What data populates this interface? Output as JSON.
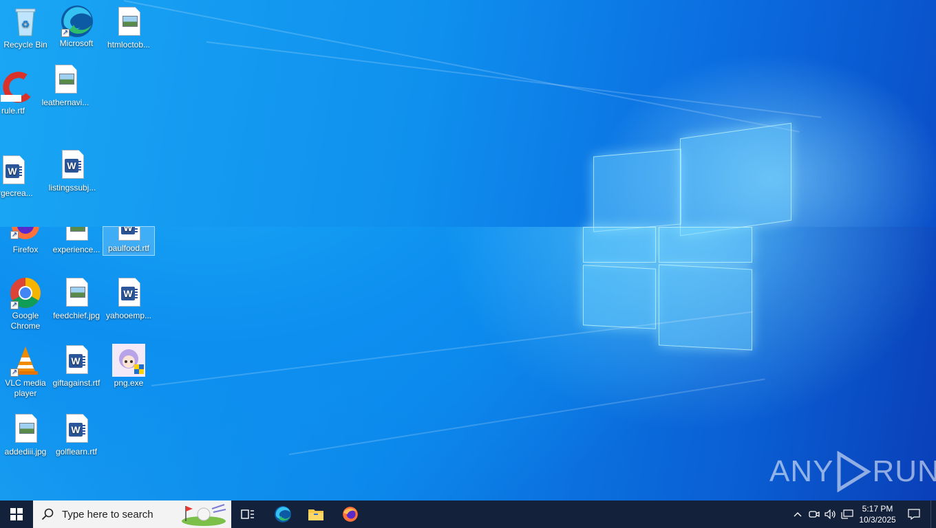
{
  "desktop_icons": [
    {
      "name": "recycle-bin",
      "label": "Recycle Bin"
    },
    {
      "name": "microsoft-edge",
      "label": "Microsoft"
    },
    {
      "name": "htmloctob",
      "label": "htmloctob..."
    },
    {
      "name": "rule-rtf",
      "label": "rule.rtf"
    },
    {
      "name": "leathernavi",
      "label": "leathernavi..."
    },
    {
      "name": "argecrea",
      "label": "argecrea..."
    },
    {
      "name": "listingssubj",
      "label": "listingssubj..."
    },
    {
      "name": "firefox",
      "label": "Firefox"
    },
    {
      "name": "experience",
      "label": "experience..."
    },
    {
      "name": "paulfood-rtf",
      "label": "paulfood.rtf"
    },
    {
      "name": "google-chrome",
      "label": "Google Chrome"
    },
    {
      "name": "feedchief-jpg",
      "label": "feedchief.jpg"
    },
    {
      "name": "yahooemp",
      "label": "yahooemp..."
    },
    {
      "name": "vlc-media-player",
      "label": "VLC media player"
    },
    {
      "name": "giftagainst-rtf",
      "label": "giftagainst.rtf"
    },
    {
      "name": "png-exe",
      "label": "png.exe"
    },
    {
      "name": "addediii-jpg",
      "label": "addediii.jpg"
    },
    {
      "name": "golflearn-rtf",
      "label": "golflearn.rtf"
    }
  ],
  "taskbar": {
    "search_placeholder": "Type here to search",
    "time": "5:17 PM",
    "date": "10/3/2025"
  },
  "watermark": {
    "left": "ANY",
    "right": "RUN"
  },
  "colors": {
    "taskbar": "#13213a",
    "desktop_accent": "#0d8ff0",
    "word_blue": "#2b579a"
  }
}
